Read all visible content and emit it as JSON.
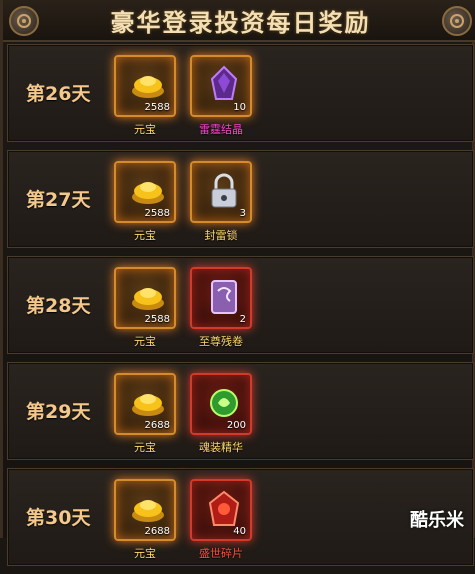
{
  "title": "豪华登录投资每日奖励",
  "watermark": "酷乐米",
  "colors": {
    "gold_glow": "#e07a1f",
    "red_glow": "#d23a2a",
    "day_text": "#f3c88a"
  },
  "rows": [
    {
      "day": "第26天",
      "rewards": [
        {
          "name": "元宝",
          "count": "2588",
          "icon": "gold-ingot-icon"
        },
        {
          "name": "雷霆结晶",
          "count": "10",
          "icon": "purple-crystal-icon"
        }
      ]
    },
    {
      "day": "第27天",
      "rewards": [
        {
          "name": "元宝",
          "count": "2588",
          "icon": "gold-ingot-icon"
        },
        {
          "name": "封雷锁",
          "count": "3",
          "icon": "lock-icon"
        }
      ]
    },
    {
      "day": "第28天",
      "rewards": [
        {
          "name": "元宝",
          "count": "2588",
          "icon": "gold-ingot-icon"
        },
        {
          "name": "至尊残卷",
          "count": "2",
          "icon": "scroll-icon"
        }
      ]
    },
    {
      "day": "第29天",
      "rewards": [
        {
          "name": "元宝",
          "count": "2688",
          "icon": "gold-ingot-icon"
        },
        {
          "name": "魂装精华",
          "count": "200",
          "icon": "green-orb-icon"
        }
      ]
    },
    {
      "day": "第30天",
      "rewards": [
        {
          "name": "元宝",
          "count": "2688",
          "icon": "gold-ingot-icon"
        },
        {
          "name": "盛世碎片",
          "count": "40",
          "icon": "red-gem-icon"
        }
      ]
    }
  ]
}
